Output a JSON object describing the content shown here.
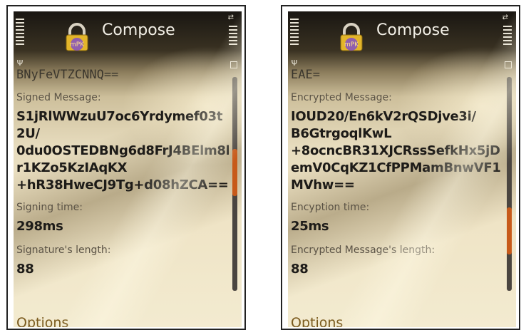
{
  "screens": [
    {
      "title": "Compose",
      "cut_line": "BNyFeVTZCNNQ==",
      "field1_label": "Signed Message:",
      "field1_lines": [
        "S1jRlWWzuU7oc6Yrdymef03t",
        "2U/",
        "0du0OSTEDBNg6d8FrJ4BElm8l",
        "r1KZo5KzIAqKX",
        "+hR38HweCJ9Tg+d08hZCA=="
      ],
      "field2_label": "Signing time:",
      "field2_value": "298ms",
      "field3_label": "Signature's length:",
      "field3_value": "88",
      "softkey": "Options",
      "scroll_position": 0.43
    },
    {
      "title": "Compose",
      "cut_line": "EAE=",
      "field1_label": "Encrypted Message:",
      "field1_lines": [
        "IOUD20/En6kV2rQSDjve3i/",
        "B6GtrgoqlKwL",
        "+8ocncBR31XJCRssSefkHx5jD",
        "emV0CqKZ1CfPPMamBnwVF1",
        "MVhw=="
      ],
      "field2_label": "Encyption time:",
      "field2_value": "25ms",
      "field3_label": "Encrypted Message's length:",
      "field3_value": "88",
      "softkey": "Options",
      "scroll_position": 0.78
    }
  ],
  "app_icon_text": "mPK",
  "colors": {
    "accent": "#c75a1a",
    "softkey": "#7a5a1e",
    "title": "#f2efe6"
  },
  "icons": [
    "signal-icon",
    "battery-icon",
    "network-icon",
    "lock-app-icon",
    "antenna-icon"
  ]
}
